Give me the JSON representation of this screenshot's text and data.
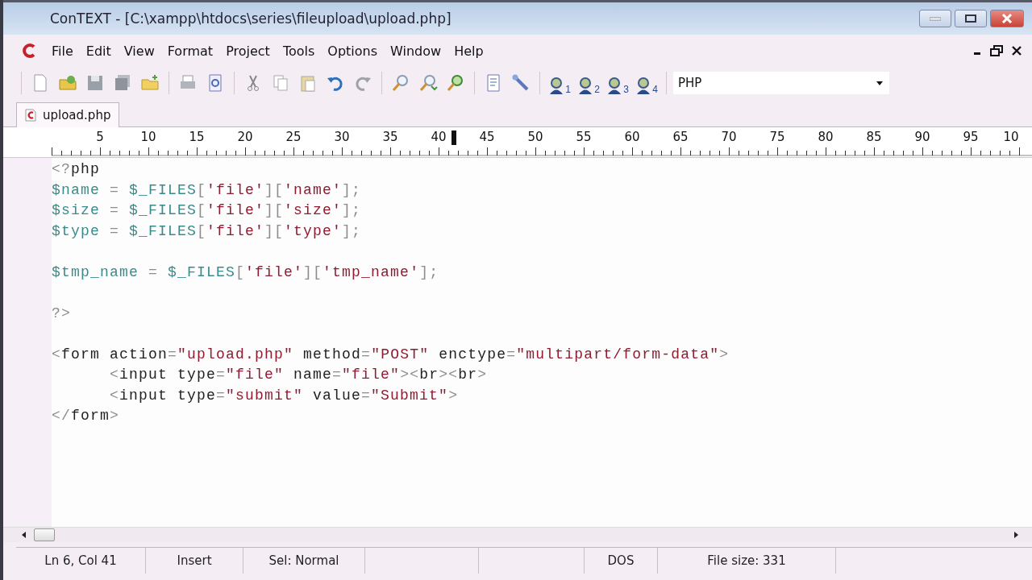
{
  "window": {
    "title": "ConTEXT - [C:\\xampp\\htdocs\\series\\fileupload\\upload.php]"
  },
  "menu": [
    "File",
    "Edit",
    "View",
    "Format",
    "Project",
    "Tools",
    "Options",
    "Window",
    "Help"
  ],
  "toolbar": {
    "user_buttons": [
      "1",
      "2",
      "3",
      "4"
    ],
    "language": "PHP"
  },
  "tabs": [
    {
      "label": "upload.php",
      "selected": true
    }
  ],
  "ruler": {
    "labels": [
      "5",
      "10",
      "15",
      "20",
      "25",
      "30",
      "35",
      "40",
      "45",
      "50",
      "55",
      "60",
      "65",
      "70",
      "75",
      "80",
      "85",
      "90",
      "95",
      "10"
    ]
  },
  "code": [
    {
      "tokens": [
        {
          "kind": "p",
          "text": "<?"
        },
        {
          "kind": "t",
          "text": "php"
        }
      ]
    },
    {
      "tokens": [
        {
          "kind": "v",
          "text": "$name"
        },
        {
          "kind": "p",
          "text": " = "
        },
        {
          "kind": "v",
          "text": "$_FILES"
        },
        {
          "kind": "p",
          "text": "["
        },
        {
          "kind": "s",
          "text": "'file'"
        },
        {
          "kind": "p",
          "text": "]["
        },
        {
          "kind": "s",
          "text": "'name'"
        },
        {
          "kind": "p",
          "text": "];"
        }
      ]
    },
    {
      "tokens": [
        {
          "kind": "v",
          "text": "$size"
        },
        {
          "kind": "p",
          "text": " = "
        },
        {
          "kind": "v",
          "text": "$_FILES"
        },
        {
          "kind": "p",
          "text": "["
        },
        {
          "kind": "s",
          "text": "'file'"
        },
        {
          "kind": "p",
          "text": "]["
        },
        {
          "kind": "s",
          "text": "'size'"
        },
        {
          "kind": "p",
          "text": "];"
        }
      ]
    },
    {
      "tokens": [
        {
          "kind": "v",
          "text": "$type"
        },
        {
          "kind": "p",
          "text": " = "
        },
        {
          "kind": "v",
          "text": "$_FILES"
        },
        {
          "kind": "p",
          "text": "["
        },
        {
          "kind": "s",
          "text": "'file'"
        },
        {
          "kind": "p",
          "text": "]["
        },
        {
          "kind": "s",
          "text": "'type'"
        },
        {
          "kind": "p",
          "text": "];"
        }
      ]
    },
    {
      "spaced": true,
      "tokens": [
        {
          "kind": "v",
          "text": "$tmp_name"
        },
        {
          "kind": "p",
          "text": " = "
        },
        {
          "kind": "v",
          "text": "$_FILES"
        },
        {
          "kind": "p",
          "text": "["
        },
        {
          "kind": "s",
          "text": "'file'"
        },
        {
          "kind": "p",
          "text": "]["
        },
        {
          "kind": "s",
          "text": "'tmp_name'"
        },
        {
          "kind": "p",
          "text": "];"
        }
      ]
    },
    {
      "spaced": true,
      "tokens": [
        {
          "kind": "p",
          "text": "?>"
        }
      ]
    },
    {
      "spaced": true,
      "tokens": [
        {
          "kind": "p",
          "text": "<"
        },
        {
          "kind": "t",
          "text": "form action"
        },
        {
          "kind": "p",
          "text": "="
        },
        {
          "kind": "s",
          "text": "\"upload.php\""
        },
        {
          "kind": "t",
          "text": " method"
        },
        {
          "kind": "p",
          "text": "="
        },
        {
          "kind": "s",
          "text": "\"POST\""
        },
        {
          "kind": "t",
          "text": " enctype"
        },
        {
          "kind": "p",
          "text": "="
        },
        {
          "kind": "s",
          "text": "\"multipart/form-data\""
        },
        {
          "kind": "p",
          "text": ">"
        }
      ]
    },
    {
      "indent": true,
      "tokens": [
        {
          "kind": "p",
          "text": "<"
        },
        {
          "kind": "t",
          "text": "input type"
        },
        {
          "kind": "p",
          "text": "="
        },
        {
          "kind": "s",
          "text": "\"file\""
        },
        {
          "kind": "t",
          "text": " name"
        },
        {
          "kind": "p",
          "text": "="
        },
        {
          "kind": "s",
          "text": "\"file\""
        },
        {
          "kind": "p",
          "text": "><"
        },
        {
          "kind": "t",
          "text": "br"
        },
        {
          "kind": "p",
          "text": "><"
        },
        {
          "kind": "t",
          "text": "br"
        },
        {
          "kind": "p",
          "text": ">"
        }
      ]
    },
    {
      "indent": true,
      "tokens": [
        {
          "kind": "p",
          "text": "<"
        },
        {
          "kind": "t",
          "text": "input type"
        },
        {
          "kind": "p",
          "text": "="
        },
        {
          "kind": "s",
          "text": "\"submit\""
        },
        {
          "kind": "t",
          "text": " value"
        },
        {
          "kind": "p",
          "text": "="
        },
        {
          "kind": "s",
          "text": "\"Submit\""
        },
        {
          "kind": "p",
          "text": ">"
        }
      ]
    },
    {
      "tokens": [
        {
          "kind": "p",
          "text": "</"
        },
        {
          "kind": "t",
          "text": "form"
        },
        {
          "kind": "p",
          "text": ">"
        }
      ]
    }
  ],
  "status_bar": [
    "Ln 6, Col 41",
    "Insert",
    "Sel: Normal",
    "DOS",
    "File size: 331"
  ]
}
